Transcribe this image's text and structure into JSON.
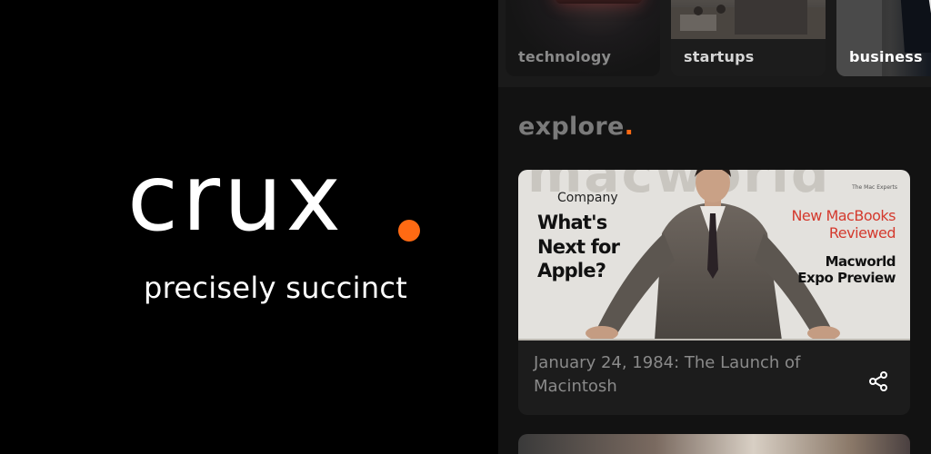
{
  "brand": {
    "name": "crux",
    "tagline": "precisely succinct",
    "accent_color": "#ff6a13"
  },
  "categories": [
    {
      "label": "technology"
    },
    {
      "label": "startups"
    },
    {
      "label": "business"
    }
  ],
  "explore": {
    "heading": "explore",
    "heading_dot": "."
  },
  "story": {
    "cover": {
      "masthead": "macworld",
      "company": "Company",
      "headline": "What's Next for Apple?",
      "red_line": "New MacBooks Reviewed",
      "expo": "Macworld Expo Preview",
      "tag": "The Mac Experts"
    },
    "caption": "January 24, 1984: The Launch of Macintosh",
    "share_icon": "share-icon"
  }
}
